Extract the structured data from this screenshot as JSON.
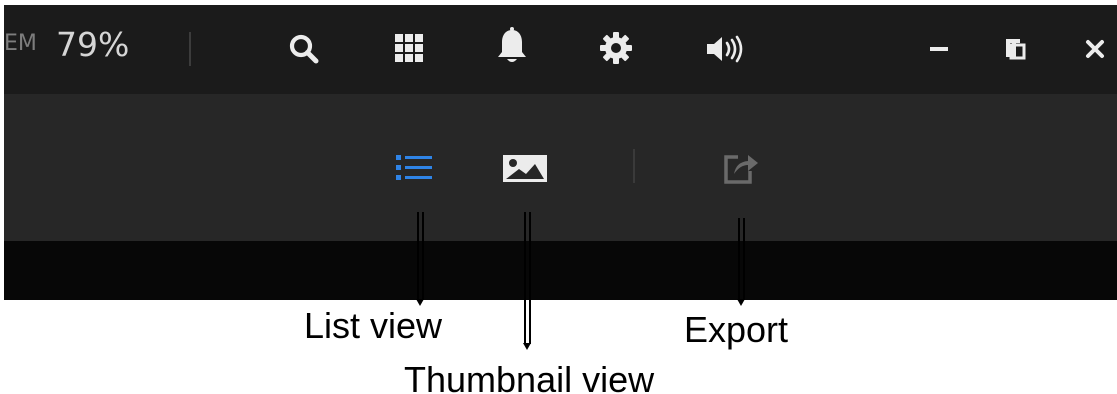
{
  "top_bar": {
    "prev_label": "EM",
    "zoom": "79%"
  },
  "icons": {
    "top_bar": [
      "search-icon",
      "grid-icon",
      "bell-icon",
      "gear-icon",
      "volume-icon",
      "minimize-icon",
      "restore-icon",
      "close-icon"
    ],
    "toolbar": [
      "list-view-icon",
      "thumbnail-view-icon",
      "export-icon"
    ]
  },
  "colors": {
    "top_bar_bg": "#1b1b1b",
    "toolbar_bg": "#272727",
    "bottom_strip_bg": "#070707",
    "icon": "#ececec",
    "active_accent": "#2f84e6",
    "disabled_icon": "#6a6a6a"
  },
  "annotations": {
    "list_view": "List view",
    "thumbnail_view": "Thumbnail view",
    "export": "Export"
  }
}
